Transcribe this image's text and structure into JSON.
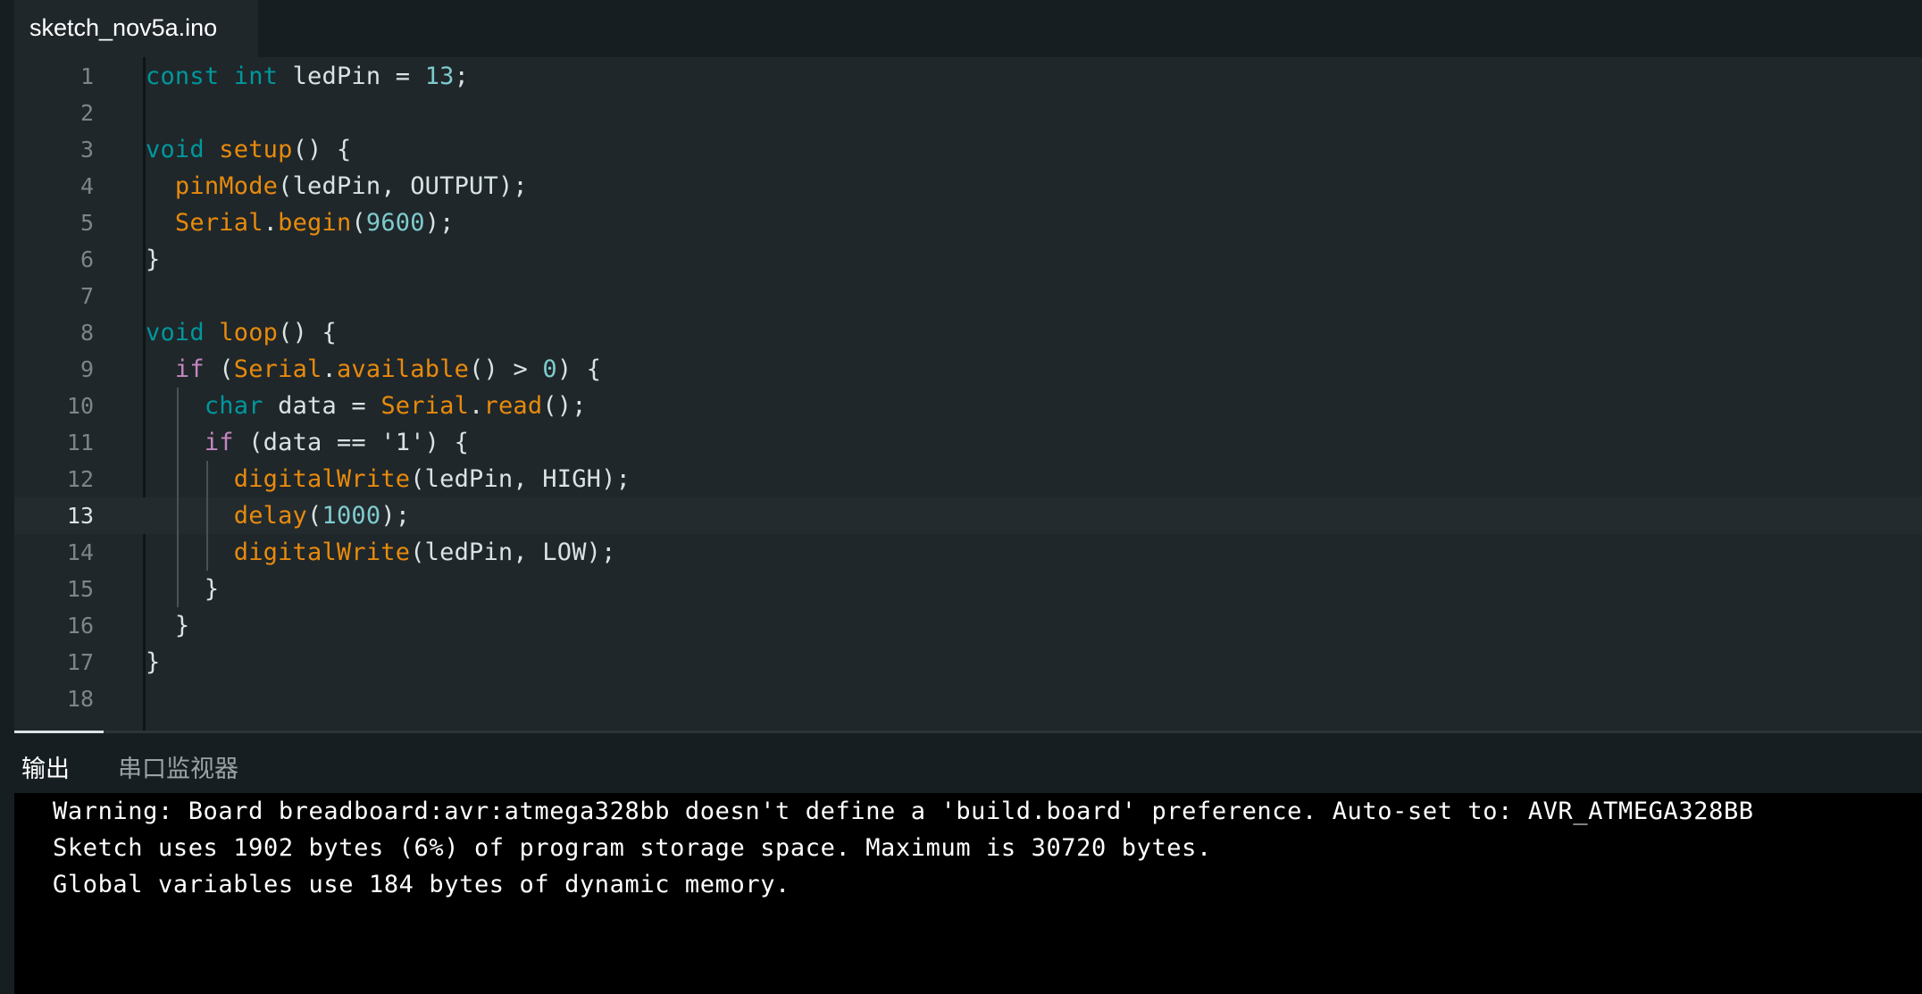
{
  "tab": {
    "filename": "sketch_nov5a.ino"
  },
  "editor": {
    "current_line": 13,
    "lines": [
      [
        [
          "kw",
          "const"
        ],
        [
          "plain",
          " "
        ],
        [
          "kw",
          "int"
        ],
        [
          "plain",
          " ledPin = "
        ],
        [
          "num",
          "13"
        ],
        [
          "plain",
          ";"
        ]
      ],
      [],
      [
        [
          "kw",
          "void"
        ],
        [
          "plain",
          " "
        ],
        [
          "fn",
          "setup"
        ],
        [
          "plain",
          "() {"
        ]
      ],
      [
        [
          "plain",
          "  "
        ],
        [
          "fn",
          "pinMode"
        ],
        [
          "plain",
          "(ledPin, OUTPUT);"
        ]
      ],
      [
        [
          "plain",
          "  "
        ],
        [
          "fn",
          "Serial"
        ],
        [
          "plain",
          "."
        ],
        [
          "fn",
          "begin"
        ],
        [
          "plain",
          "("
        ],
        [
          "num",
          "9600"
        ],
        [
          "plain",
          ");"
        ]
      ],
      [
        [
          "plain",
          "}"
        ]
      ],
      [],
      [
        [
          "kw",
          "void"
        ],
        [
          "plain",
          " "
        ],
        [
          "fn",
          "loop"
        ],
        [
          "plain",
          "() {"
        ]
      ],
      [
        [
          "plain",
          "  "
        ],
        [
          "ctl",
          "if"
        ],
        [
          "plain",
          " ("
        ],
        [
          "fn",
          "Serial"
        ],
        [
          "plain",
          "."
        ],
        [
          "fn",
          "available"
        ],
        [
          "plain",
          "() > "
        ],
        [
          "num",
          "0"
        ],
        [
          "plain",
          ") {"
        ]
      ],
      [
        [
          "plain",
          "    "
        ],
        [
          "kw",
          "char"
        ],
        [
          "plain",
          " data = "
        ],
        [
          "fn",
          "Serial"
        ],
        [
          "plain",
          "."
        ],
        [
          "fn",
          "read"
        ],
        [
          "plain",
          "();"
        ]
      ],
      [
        [
          "plain",
          "    "
        ],
        [
          "ctl",
          "if"
        ],
        [
          "plain",
          " (data == '1') {"
        ]
      ],
      [
        [
          "plain",
          "      "
        ],
        [
          "fn",
          "digitalWrite"
        ],
        [
          "plain",
          "(ledPin, HIGH);"
        ]
      ],
      [
        [
          "plain",
          "      "
        ],
        [
          "fn",
          "delay"
        ],
        [
          "plain",
          "("
        ],
        [
          "num",
          "1000"
        ],
        [
          "plain",
          ");"
        ]
      ],
      [
        [
          "plain",
          "      "
        ],
        [
          "fn",
          "digitalWrite"
        ],
        [
          "plain",
          "(ledPin, LOW);"
        ]
      ],
      [
        [
          "plain",
          "    }"
        ]
      ],
      [
        [
          "plain",
          "  }"
        ]
      ],
      [
        [
          "plain",
          "}"
        ]
      ],
      []
    ]
  },
  "panel": {
    "tabs": [
      {
        "label": "输出",
        "active": true
      },
      {
        "label": "串口监视器",
        "active": false
      }
    ],
    "output_lines": [
      "Warning: Board breadboard:avr:atmega328bb doesn't define a 'build.board' preference. Auto-set to: AVR_ATMEGA328BB",
      "Sketch uses 1902 bytes (6%) of program storage space. Maximum is 30720 bytes.",
      "Global variables use 184 bytes of dynamic memory."
    ]
  },
  "colors": {
    "keyword": "#00979d",
    "function": "#e88a0d",
    "number": "#7fcbcd",
    "control": "#c586c0",
    "editor_bg": "#1f272a",
    "output_bg": "#000000"
  }
}
